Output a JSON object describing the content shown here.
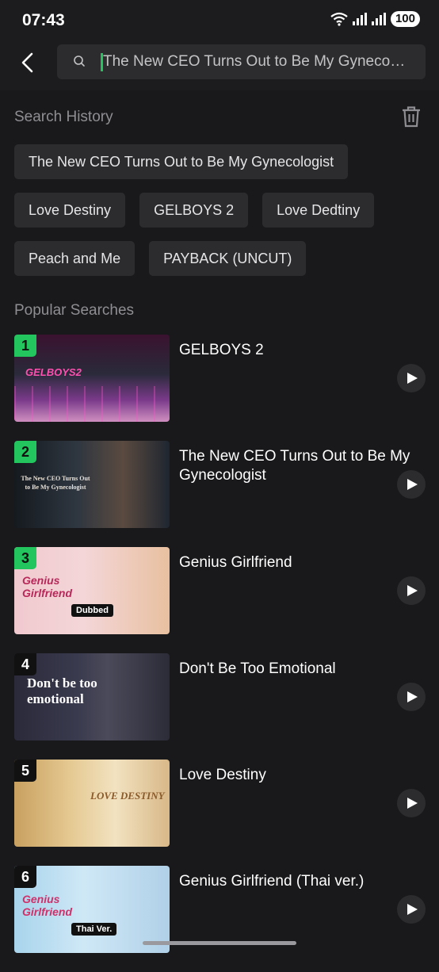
{
  "status": {
    "time": "07:43",
    "battery": "100"
  },
  "search": {
    "value": "The New CEO Turns Out to Be My Gynecologist"
  },
  "history": {
    "title": "Search History",
    "rows": [
      [
        "The New CEO Turns Out to Be My Gynecologist"
      ],
      [
        "Love Destiny",
        "GELBOYS 2",
        "Love Dedtiny"
      ],
      [
        "Peach and Me",
        "PAYBACK (UNCUT)"
      ]
    ]
  },
  "popular": {
    "title": "Popular Searches",
    "items": [
      {
        "rank": "1",
        "title": "GELBOYS 2",
        "caption": "GELBOYS2"
      },
      {
        "rank": "2",
        "title": "The New CEO Turns Out to Be My Gynecologist",
        "caption": "The New CEO Turns Out to Be My Gynecologist"
      },
      {
        "rank": "3",
        "title": "Genius Girlfriend",
        "caption": "Genius Girlfriend",
        "badge": "Dubbed"
      },
      {
        "rank": "4",
        "title": "Don't Be Too Emotional",
        "caption": "Don't be too emotional"
      },
      {
        "rank": "5",
        "title": "Love Destiny",
        "caption": "LOVE DESTINY"
      },
      {
        "rank": "6",
        "title": "Genius Girlfriend (Thai ver.)",
        "caption": "Genius Girlfriend",
        "badge": "Thai Ver."
      }
    ]
  },
  "colors": {
    "accent": "#22c55e",
    "background": "#19191b",
    "chip": "#2c2c2e"
  },
  "icons": [
    "wifi-icon",
    "signal-icon",
    "back-arrow-icon",
    "search-icon",
    "trash-icon",
    "play-icon"
  ]
}
